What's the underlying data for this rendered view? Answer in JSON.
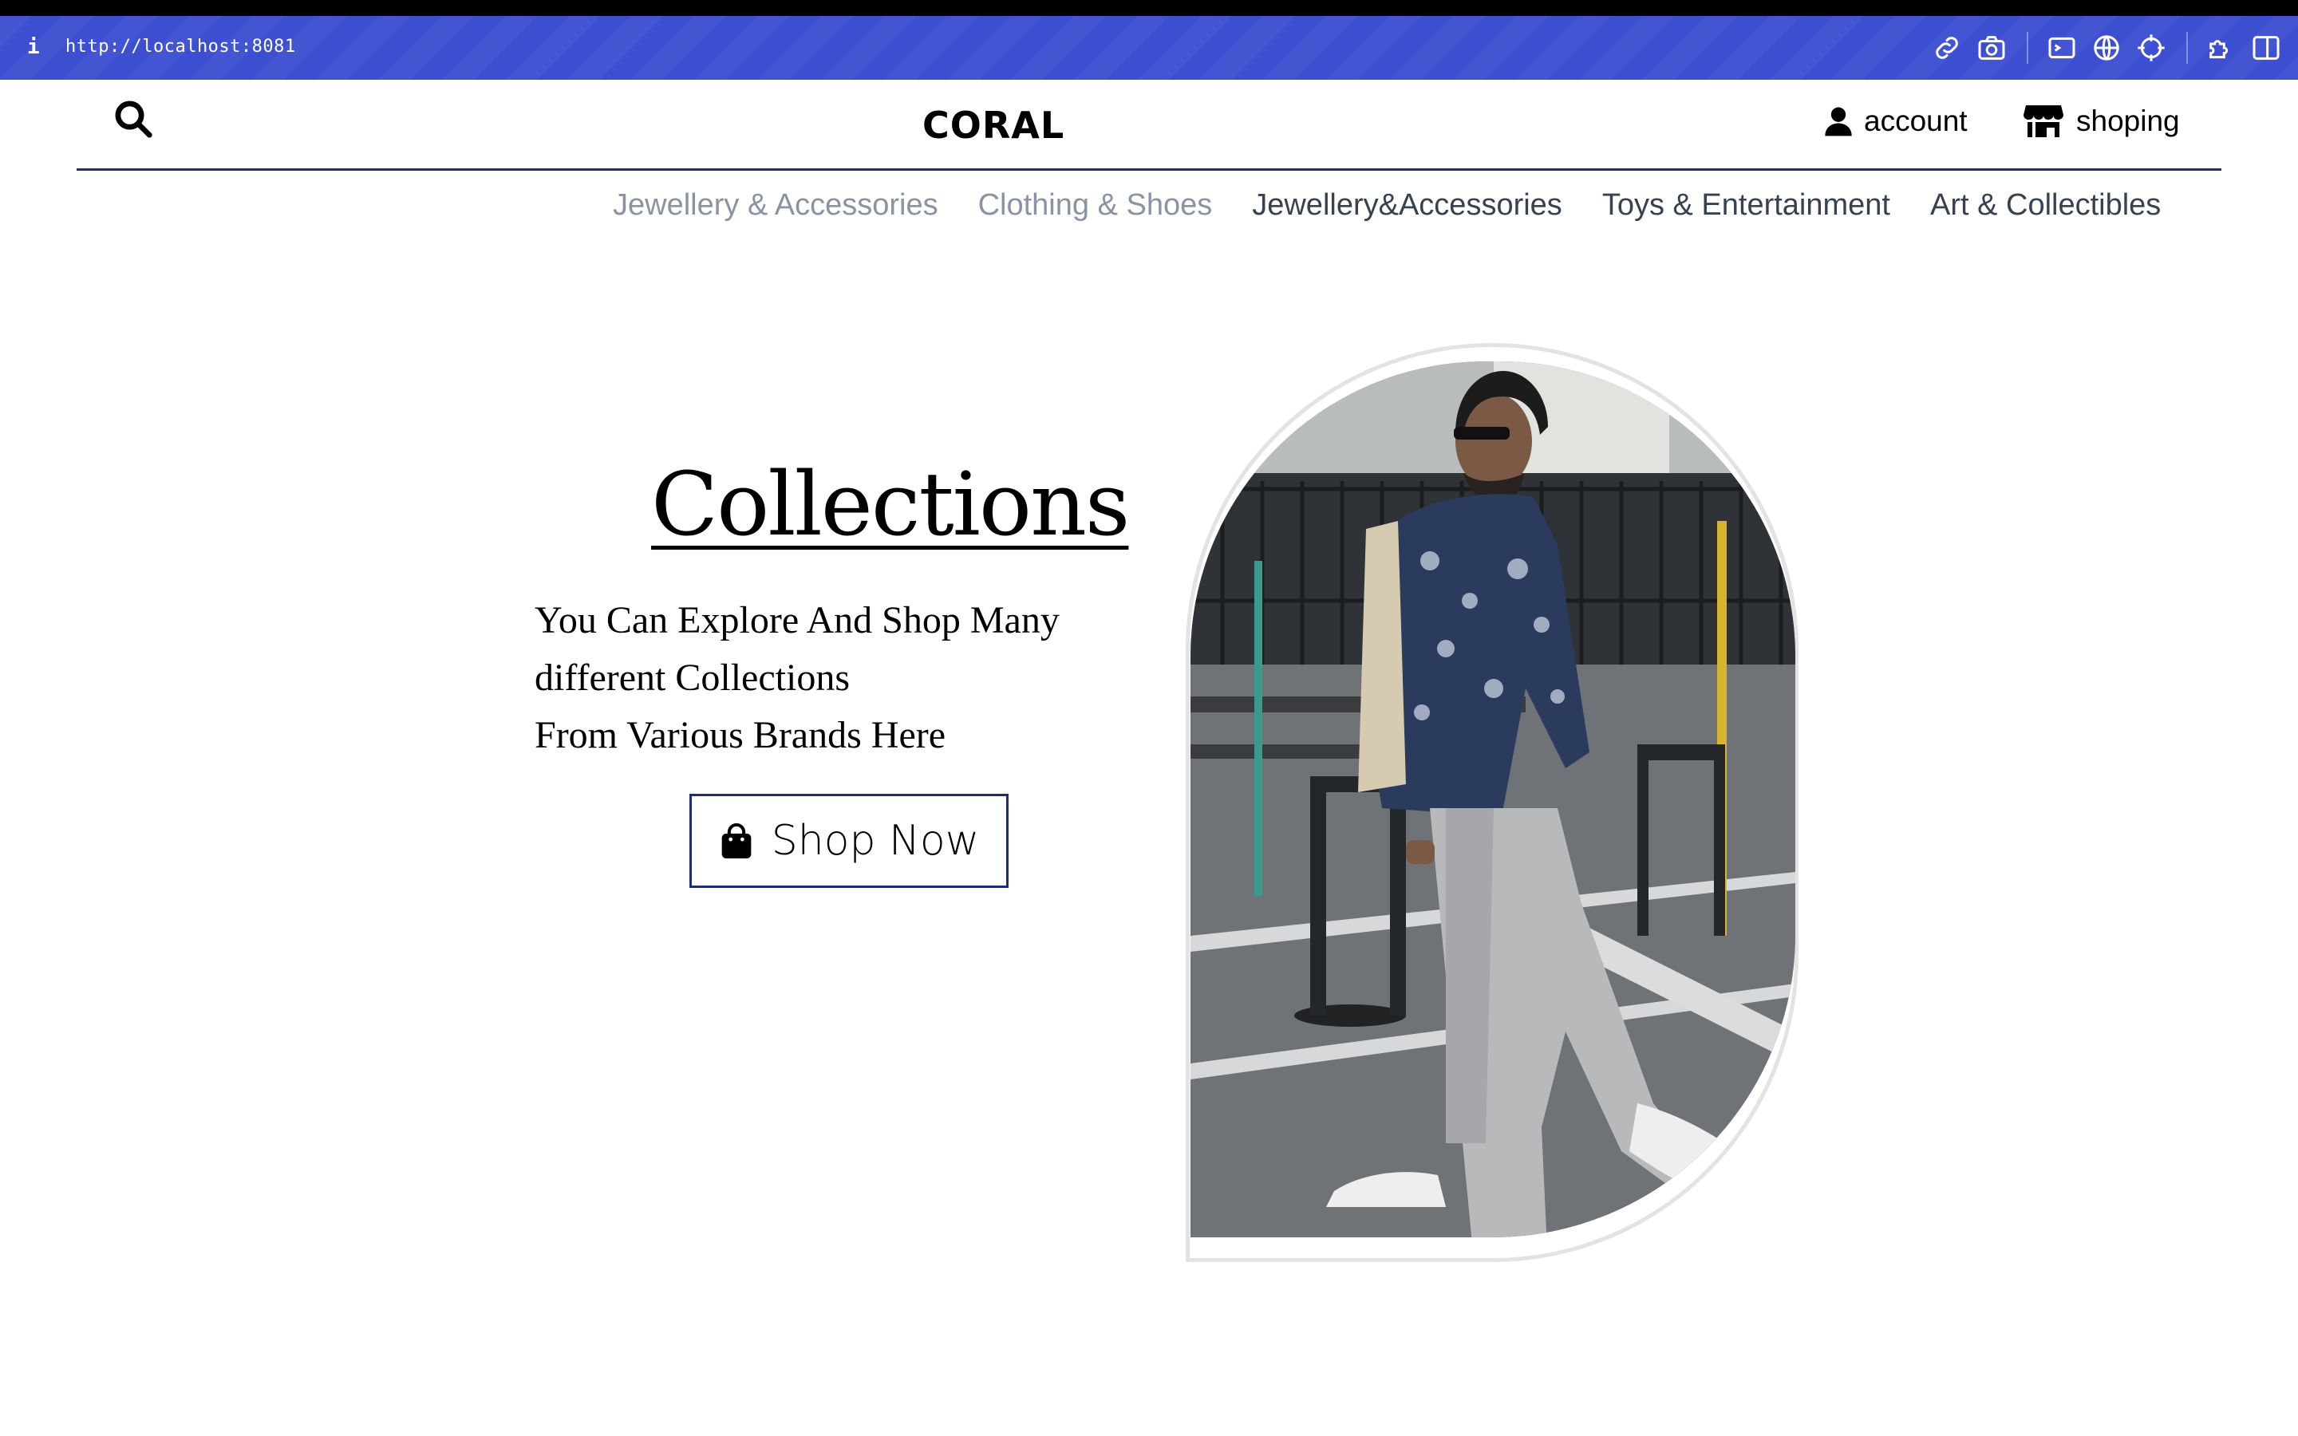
{
  "browser": {
    "info_icon": "info-icon",
    "url": "http://localhost:8081",
    "toolbar_icons": [
      "link-icon",
      "camera-icon",
      "terminal-icon",
      "globe-icon",
      "crosshair-icon",
      "extension-icon",
      "sidebar-icon"
    ]
  },
  "header": {
    "brand": "CORAL",
    "search_icon": "search-icon",
    "account_label": "account",
    "account_icon": "user-icon",
    "shop_label": "shoping",
    "shop_icon": "store-icon"
  },
  "nav": {
    "items": [
      {
        "label": "Jewellery & Accessories"
      },
      {
        "label": "Clothing & Shoes"
      },
      {
        "label": "Jewellery&Accessories"
      },
      {
        "label": "Toys & Entertainment"
      },
      {
        "label": "Art & Collectibles"
      }
    ]
  },
  "hero": {
    "title": "Collections",
    "description_lines": [
      "You Can Explore And Shop Many",
      "different Collections",
      "From Various Brands Here"
    ],
    "button_label": "Shop Now",
    "button_icon": "shopping-bag-icon"
  },
  "colors": {
    "url_bar": "#3d4fd1",
    "accent": "#1f2d6b",
    "nav_muted": "#8a93a3",
    "nav_dark": "#374151"
  }
}
